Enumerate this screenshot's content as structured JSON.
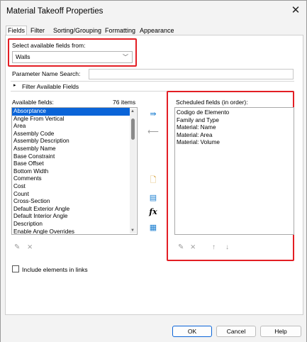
{
  "window": {
    "title": "Material Takeoff Properties"
  },
  "tabs": [
    {
      "label": "Fields",
      "active": true
    },
    {
      "label": "Filter"
    },
    {
      "label": "Sorting/Grouping"
    },
    {
      "label": "Formatting"
    },
    {
      "label": "Appearance"
    }
  ],
  "source": {
    "label": "Select available fields from:",
    "value": "Walls"
  },
  "search": {
    "label": "Parameter Name Search:",
    "value": ""
  },
  "filter": {
    "label": "Filter Available Fields"
  },
  "available": {
    "label": "Available fields:",
    "count": "76 items",
    "items": [
      "Absorptance",
      "Angle From Vertical",
      "Area",
      "Assembly Code",
      "Assembly Description",
      "Assembly Name",
      "Base Constraint",
      "Base Offset",
      "Bottom Width",
      "Comments",
      "Cost",
      "Count",
      "Cross-Section",
      "Default Exterior Angle",
      "Default Interior Angle",
      "Description",
      "Enable Angle Overrides"
    ],
    "selected_index": 0
  },
  "scheduled": {
    "label": "Scheduled fields (in order):",
    "items": [
      "Codigo de Elemento",
      "Family and Type",
      "Material: Name",
      "Material: Area",
      "Material: Volume"
    ]
  },
  "include_links": {
    "label": "Include elements in links",
    "checked": false
  },
  "buttons": {
    "ok": "OK",
    "cancel": "Cancel",
    "help": "Help"
  },
  "colors": {
    "highlight": "#e31e24",
    "selection": "#0a64d8"
  }
}
